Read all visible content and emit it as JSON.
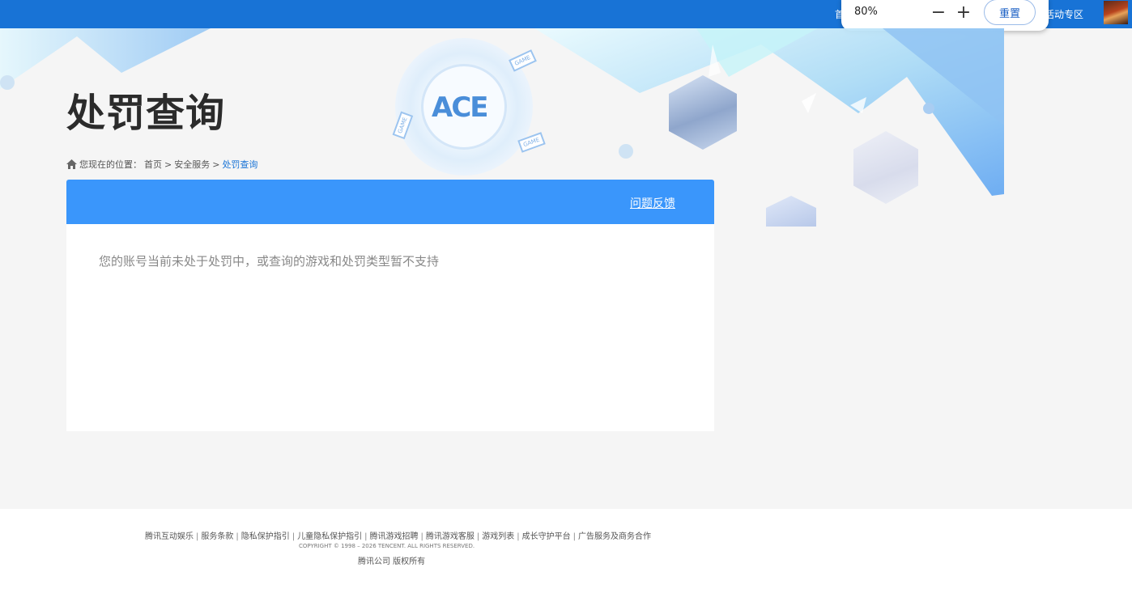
{
  "topbar": {
    "nav_left_partial": "首",
    "nav_right_partial": "活动专区"
  },
  "zoom": {
    "value": "80%",
    "minus": "−",
    "plus": "+",
    "reset": "重置"
  },
  "banner": {
    "logo_text": "ACE",
    "game_tag": "GAME"
  },
  "page": {
    "title": "处罚查询"
  },
  "breadcrumb": {
    "prefix": "您现在的位置：",
    "items": [
      "首页",
      "安全服务",
      "处罚查询"
    ],
    "separator": ">"
  },
  "panel": {
    "feedback_link": "问题反馈",
    "notice": "您的账号当前未处于处罚中，或查询的游戏和处罚类型暂不支持"
  },
  "footer": {
    "links": [
      "腾讯互动娱乐",
      "服务条款",
      "隐私保护指引",
      "儿童隐私保护指引",
      "腾讯游戏招聘",
      "腾讯游戏客服",
      "游戏列表",
      "成长守护平台",
      "广告服务及商务合作"
    ],
    "copyright": "COPYRIGHT © 1998 – 2026 TENCENT. ALL RIGHTS RESERVED.",
    "company": "腾讯公司 版权所有"
  },
  "colors": {
    "topbar": "#1873d6",
    "panel_header": "#3a96fb",
    "link_blue": "#1873d6"
  }
}
